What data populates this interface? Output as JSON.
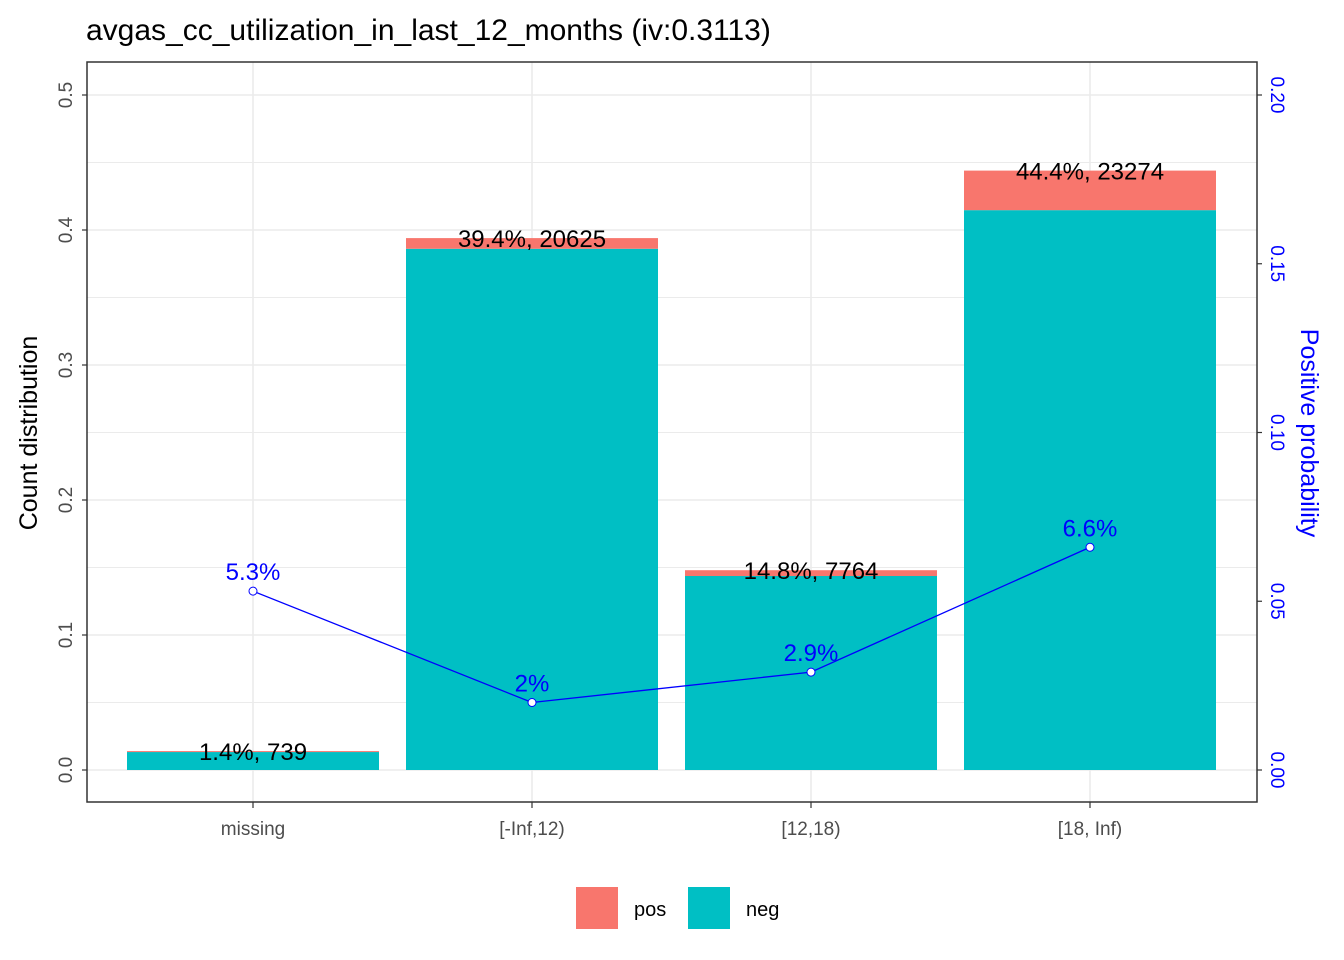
{
  "chart_data": {
    "type": "bar",
    "title": "avgas_cc_utilization_in_last_12_months  (iv:0.3113)",
    "categories": [
      "missing",
      "[-Inf,12)",
      "[12,18)",
      "[18, Inf)"
    ],
    "series": [
      {
        "name": "pos",
        "values": [
          0.0007,
          0.0079,
          0.0043,
          0.0293
        ]
      },
      {
        "name": "neg",
        "values": [
          0.0133,
          0.3861,
          0.1437,
          0.4147
        ]
      }
    ],
    "bar_labels": [
      "1.4%, 739",
      "39.4%, 20625",
      "14.8%, 7764",
      "44.4%, 23274"
    ],
    "bar_totals": [
      0.014,
      0.394,
      0.148,
      0.444
    ],
    "positive_probability": {
      "values": [
        0.053,
        0.02,
        0.029,
        0.066
      ],
      "labels": [
        "5.3%",
        "2%",
        "2.9%",
        "6.6%"
      ]
    },
    "ylabel": "Count distribution",
    "ylabel_right": "Positive probability",
    "ylim": [
      0,
      0.5
    ],
    "ylim_right": [
      0,
      0.2
    ],
    "yticks": [
      "0.0",
      "0.1",
      "0.2",
      "0.3",
      "0.4",
      "0.5"
    ],
    "yticks_right": [
      "0.00",
      "0.05",
      "0.10",
      "0.15",
      "0.20"
    ],
    "legend": {
      "placement": "bottom",
      "items": [
        "pos",
        "neg"
      ]
    },
    "colors": {
      "pos": "#F8766D",
      "neg": "#00BFC4",
      "line": "#0000FF",
      "grid": "#EBEBEB"
    },
    "grid": true
  }
}
